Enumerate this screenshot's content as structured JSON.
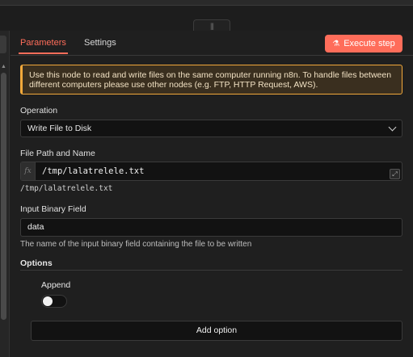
{
  "tabs": {
    "parameters": "Parameters",
    "settings": "Settings"
  },
  "execute_button": {
    "label": "Execute step",
    "icon": "flask-icon"
  },
  "notice": "Use this node to read and write files on the same computer running n8n. To handle files between different computers please use other nodes (e.g. FTP, HTTP Request, AWS).",
  "operation": {
    "label": "Operation",
    "value": "Write File to Disk"
  },
  "file_path": {
    "label": "File Path and Name",
    "prefix": "fx",
    "value": "/tmp/lalatrelele.txt",
    "preview": "/tmp/lalatrelele.txt"
  },
  "binary_field": {
    "label": "Input Binary Field",
    "value": "data",
    "hint": "The name of the input binary field containing the file to be written"
  },
  "options": {
    "title": "Options",
    "append_label": "Append",
    "append_enabled": false,
    "add_option": "Add option"
  },
  "colors": {
    "accent": "#ff6d5a",
    "notice_border": "#f2a93b"
  }
}
